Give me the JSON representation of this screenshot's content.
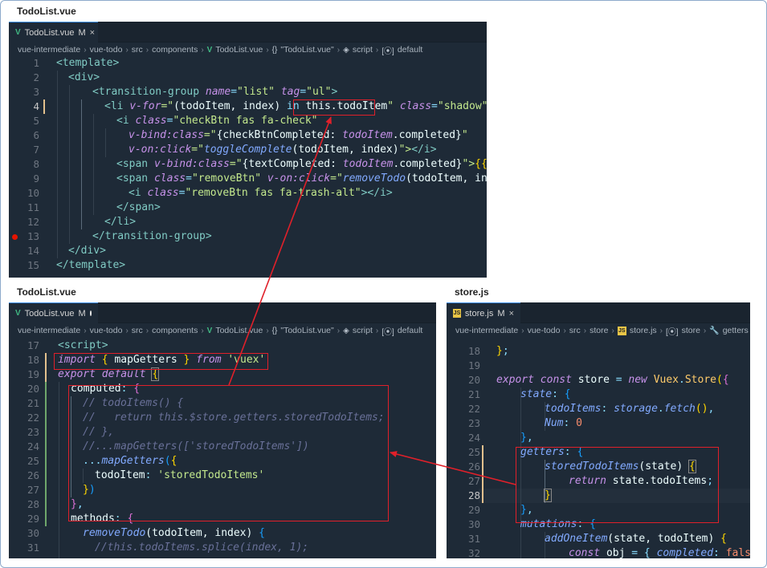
{
  "captions": {
    "top": "TodoList.vue",
    "bottom_left": "TodoList.vue",
    "bottom_right": "store.js"
  },
  "pane_top": {
    "tab": {
      "icon": "vue-icon",
      "name": "TodoList.vue",
      "mark": "M",
      "close": "×"
    },
    "breadcrumb": [
      "vue-intermediate",
      "vue-todo",
      "src",
      "components",
      "TodoList.vue",
      "\"TodoList.vue\"",
      "script",
      "default"
    ],
    "line_numbers": [
      "1",
      "2",
      "3",
      "4",
      "5",
      "6",
      "7",
      "8",
      "9",
      "10",
      "11",
      "12",
      "13",
      "14",
      "15"
    ]
  },
  "pane_bl": {
    "tab": {
      "icon": "vue-icon",
      "name": "TodoList.vue",
      "mark": "M"
    },
    "breadcrumb": [
      "vue-intermediate",
      "vue-todo",
      "src",
      "components",
      "TodoList.vue",
      "\"TodoList.vue\"",
      "script",
      "default"
    ],
    "line_numbers": [
      "17",
      "18",
      "19",
      "20",
      "21",
      "22",
      "23",
      "24",
      "25",
      "26",
      "27",
      "28",
      "29",
      "30",
      "31"
    ]
  },
  "pane_br": {
    "tab": {
      "icon": "js-icon",
      "icon_text": "JS",
      "name": "store.js",
      "mark": "M",
      "close": "×"
    },
    "breadcrumb": [
      "vue-intermediate",
      "vue-todo",
      "src",
      "store",
      "store.js",
      "store",
      "getters"
    ],
    "line_numbers": [
      "18",
      "19",
      "20",
      "21",
      "22",
      "23",
      "24",
      "25",
      "26",
      "27",
      "28",
      "29",
      "30",
      "31",
      "32"
    ]
  },
  "code": {
    "t1": "<template>",
    "t2": "<div>",
    "t3a": "<transition-group ",
    "t3b": "name",
    "t3c": "=",
    "t3d": "\"list\"",
    "t3e": " tag",
    "t3f": "=",
    "t3g": "\"ul\"",
    "t3h": ">",
    "t4a": "<li ",
    "t4b": "v-for",
    "t4c": "=\"",
    "t4d": "(todoItem, index) ",
    "t4e": "in ",
    "t4f": "this",
    "t4g": ".todoItem",
    "t4h": "\" ",
    "t4i": "class",
    "t4j": "=",
    "t4k": "\"shadow\"",
    "t4l": " v-",
    "t5a": "<i ",
    "t5b": "class",
    "t5c": "=",
    "t5d": "\"checkBtn fas fa-check\"",
    "t6a": "v-bind:class",
    "t6b": "=\"",
    "t6c": "{checkBtnCompleted: ",
    "t6d": "todoItem",
    "t6e": ".completed}",
    "t6f": "\"",
    "t7a": "v-on:click",
    "t7b": "=\"",
    "t7c": "toggleComplete",
    "t7d": "(todoItem, index)",
    "t7e": "\">",
    "t7f": "</i>",
    "t8a": "<span ",
    "t8b": "v-bind:class",
    "t8c": "=\"",
    "t8d": "{textCompleted: ",
    "t8e": "todoItem",
    "t8f": ".completed}",
    "t8g": "\">",
    "t8h": "{{ ",
    "t8i": "to",
    "t9a": "<span ",
    "t9b": "class",
    "t9c": "=",
    "t9d": "\"removeBtn\"",
    "t9e": " v-on:click",
    "t9f": "=\"",
    "t9g": "removeTodo",
    "t9h": "(todoItem, index",
    "t10a": "<i ",
    "t10b": "class",
    "t10c": "=",
    "t10d": "\"removeBtn fas fa-trash-alt\"",
    "t10e": "></i>",
    "t11": "</span>",
    "t12": "</li>",
    "t13": "</transition-group>",
    "t14": "</div>",
    "t15": "</template>",
    "b17": "<script>",
    "b18a": "import",
    "b18b": " { ",
    "b18c": "mapGetters",
    "b18d": " } ",
    "b18e": "from",
    "b18f": " 'vuex'",
    "b19a": "export",
    "b19b": " default ",
    "b19c": "{",
    "b20a": "computed",
    "b20b": ": ",
    "b20c": "{",
    "b21": "// todoItems() {",
    "b22": "//   return this.$store.getters.storedTodoItems;",
    "b23": "// },",
    "b24": "//...mapGetters(['storedTodoItems'])",
    "b25a": "...",
    "b25b": "mapGetters",
    "b25c": "(",
    "b25d": "{",
    "b26a": "todoItem",
    "b26b": ": ",
    "b26c": "'storedTodoItems'",
    "b27a": "}",
    "b27b": ")",
    "b28a": "}",
    "b28b": ",",
    "b29a": "methods",
    "b29b": ": ",
    "b29c": "{",
    "b30a": "removeTodo",
    "b30b": "(todoItem, index) ",
    "b30c": "{",
    "b31": "//this.todoItems.splice(index, 1);",
    "s18a": "}",
    "s18b": ";",
    "s20a": "export",
    "s20b": " const ",
    "s20c": "store",
    "s20d": " = ",
    "s20e": "new ",
    "s20f": "Vuex",
    "s20g": ".",
    "s20h": "Store",
    "s20i": "(",
    "s20j": "{",
    "s21a": "state",
    "s21b": ": ",
    "s21c": "{",
    "s22a": "todoItems",
    "s22b": ": ",
    "s22c": "storage",
    "s22d": ".",
    "s22e": "fetch",
    "s22f": "()",
    "s22g": ",",
    "s23a": "Num",
    "s23b": ": ",
    "s23c": "0",
    "s24a": "}",
    "s24b": ",",
    "s25a": "getters",
    "s25b": ": ",
    "s25c": "{",
    "s26a": "storedTodoItems",
    "s26b": "(state) ",
    "s26c": "{",
    "s27a": "return",
    "s27b": " state",
    "s27c": ".todoItems",
    "s27d": ";",
    "s28": "}",
    "s29a": "}",
    "s29b": ",",
    "s30a": "mutations",
    "s30b": ": ",
    "s30c": "{",
    "s31a": "addOneItem",
    "s31b": "(state, todoItem) ",
    "s31c": "{",
    "s32a": "const",
    "s32b": " obj ",
    "s32c": "= { ",
    "s32d": "completed",
    "s32e": ": ",
    "s32f": "false"
  }
}
